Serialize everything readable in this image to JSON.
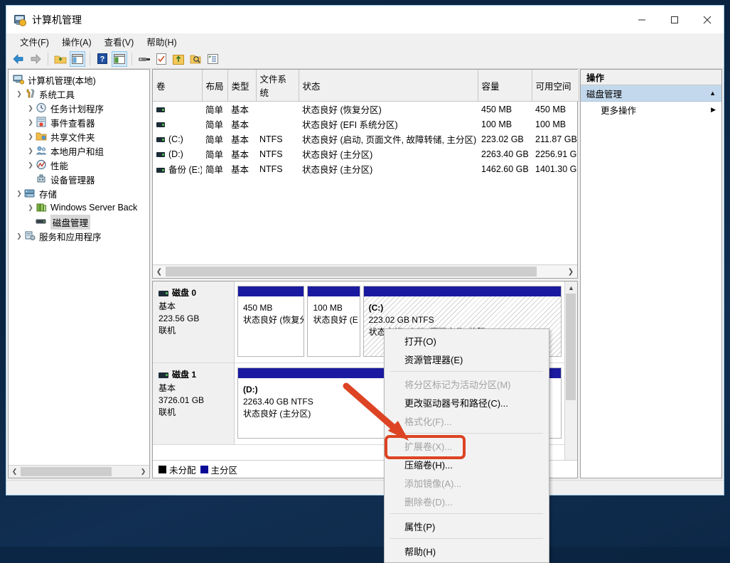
{
  "window": {
    "title": "计算机管理",
    "icon": "computer-management-icon",
    "minimize": "—",
    "maximize": "□",
    "close": "✕"
  },
  "menubar": [
    "文件(F)",
    "操作(A)",
    "查看(V)",
    "帮助(H)"
  ],
  "toolbar": [
    {
      "name": "back-icon",
      "label": "后退"
    },
    {
      "name": "forward-icon",
      "label": "前进"
    },
    {
      "name": "up-folder-icon",
      "label": "上移一级"
    },
    {
      "name": "show-hide-tree-icon",
      "label": "显示/隐藏控制台树",
      "selected": true
    },
    {
      "name": "help-icon",
      "label": "帮助"
    },
    {
      "name": "show-action-pane-icon",
      "label": "显示/隐藏操作窗格",
      "selected": true
    },
    {
      "name": "properties-icon",
      "label": "属性"
    },
    {
      "name": "checklist-icon",
      "label": "任务"
    },
    {
      "name": "export-icon",
      "label": "导出列表"
    },
    {
      "name": "search-icon",
      "label": "搜索"
    },
    {
      "name": "detail-view-icon",
      "label": "详细信息"
    }
  ],
  "tree": {
    "root": {
      "label": "计算机管理(本地)",
      "icon": "computer-icon"
    },
    "items": [
      {
        "label": "系统工具",
        "icon": "tools-icon",
        "depth": 1,
        "expander": "v"
      },
      {
        "label": "任务计划程序",
        "icon": "clock-icon",
        "depth": 2,
        "expander": ">"
      },
      {
        "label": "事件查看器",
        "icon": "event-log-icon",
        "depth": 2,
        "expander": ">"
      },
      {
        "label": "共享文件夹",
        "icon": "shared-folder-icon",
        "depth": 2,
        "expander": ">"
      },
      {
        "label": "本地用户和组",
        "icon": "users-icon",
        "depth": 2,
        "expander": ">"
      },
      {
        "label": "性能",
        "icon": "performance-icon",
        "depth": 2,
        "expander": ">"
      },
      {
        "label": "设备管理器",
        "icon": "device-manager-icon",
        "depth": 2,
        "expander": ""
      },
      {
        "label": "存储",
        "icon": "storage-icon",
        "depth": 1,
        "expander": "v"
      },
      {
        "label": "Windows Server Back",
        "icon": "backup-icon",
        "depth": 2,
        "expander": ">"
      },
      {
        "label": "磁盘管理",
        "icon": "disk-management-icon",
        "depth": 2,
        "expander": "",
        "selected": true
      },
      {
        "label": "服务和应用程序",
        "icon": "services-icon",
        "depth": 1,
        "expander": ">"
      }
    ]
  },
  "volumes": {
    "columns": [
      "卷",
      "布局",
      "类型",
      "文件系统",
      "状态",
      "容量",
      "可用空间"
    ],
    "rows": [
      {
        "volume": "",
        "layout": "简单",
        "type": "基本",
        "fs": "",
        "status": "状态良好 (恢复分区)",
        "capacity": "450 MB",
        "free": "450 MB"
      },
      {
        "volume": "",
        "layout": "简单",
        "type": "基本",
        "fs": "",
        "status": "状态良好 (EFI 系统分区)",
        "capacity": "100 MB",
        "free": "100 MB"
      },
      {
        "volume": "(C:)",
        "layout": "简单",
        "type": "基本",
        "fs": "NTFS",
        "status": "状态良好 (启动, 页面文件, 故障转储, 主分区)",
        "capacity": "223.02 GB",
        "free": "211.87 GB"
      },
      {
        "volume": "(D:)",
        "layout": "简单",
        "type": "基本",
        "fs": "NTFS",
        "status": "状态良好 (主分区)",
        "capacity": "2263.40 GB",
        "free": "2256.91 G"
      },
      {
        "volume": "备份 (E:)",
        "layout": "简单",
        "type": "基本",
        "fs": "NTFS",
        "status": "状态良好 (主分区)",
        "capacity": "1462.60 GB",
        "free": "1401.30 G"
      }
    ]
  },
  "disks": [
    {
      "name": "磁盘 0",
      "type": "基本",
      "size": "223.56 GB",
      "state": "联机",
      "partitions": [
        {
          "title": "",
          "size": "450 MB",
          "status": "状态良好 (恢复分",
          "flex": 100,
          "selected": false
        },
        {
          "title": "",
          "size": "100 MB",
          "status": "状态良好 (E",
          "flex": 78,
          "selected": false
        },
        {
          "title": "(C:)",
          "size": "223.02 GB NTFS",
          "status": "状态良好 (启动, 页面文件, 故障",
          "flex": 300,
          "selected": true
        }
      ]
    },
    {
      "name": "磁盘 1",
      "type": "基本",
      "size": "3726.01 GB",
      "state": "联机",
      "partitions": [
        {
          "title": "(D:)",
          "size": "2263.40 GB NTFS",
          "status": "状态良好 (主分区)",
          "flex": 280,
          "selected": false
        },
        {
          "title": "",
          "size": "",
          "status": "",
          "flex": 180,
          "selected": false
        }
      ]
    }
  ],
  "legend": [
    {
      "label": "未分配",
      "color": "#000000"
    },
    {
      "label": "主分区",
      "color": "#0a0a96"
    }
  ],
  "actions": {
    "header": "操作",
    "group": {
      "label": "磁盘管理",
      "chevron": "▲"
    },
    "items": [
      {
        "label": "更多操作",
        "chevron": "▶"
      }
    ]
  },
  "context_menu": {
    "items": [
      {
        "label": "打开(O)",
        "disabled": false
      },
      {
        "label": "资源管理器(E)",
        "disabled": false
      },
      {
        "separator": true
      },
      {
        "label": "将分区标记为活动分区(M)",
        "disabled": true
      },
      {
        "label": "更改驱动器号和路径(C)...",
        "disabled": false
      },
      {
        "label": "格式化(F)...",
        "disabled": true
      },
      {
        "separator": true
      },
      {
        "label": "扩展卷(X)...",
        "disabled": true
      },
      {
        "label": "压缩卷(H)...",
        "disabled": false,
        "highlighted": true
      },
      {
        "label": "添加镜像(A)...",
        "disabled": true
      },
      {
        "label": "删除卷(D)...",
        "disabled": true
      },
      {
        "separator": true
      },
      {
        "label": "属性(P)",
        "disabled": false
      },
      {
        "separator": true
      },
      {
        "label": "帮助(H)",
        "disabled": false
      }
    ]
  },
  "annotation": {
    "arrow_color": "#dd4424",
    "highlight_color": "#dd4424",
    "target": "压缩卷(H)..."
  }
}
